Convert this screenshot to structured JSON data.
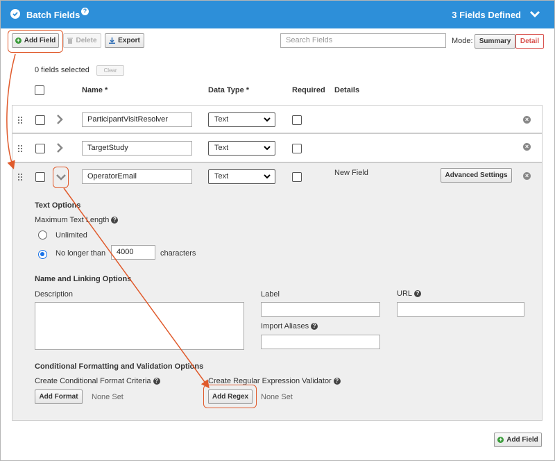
{
  "header": {
    "title": "Batch Fields",
    "help_icon": "?",
    "fields_count": "3 Fields Defined",
    "bg_color": "#2d8fd9"
  },
  "toolbar": {
    "add_field": "Add Field",
    "delete": "Delete",
    "export": "Export",
    "search_placeholder": "Search Fields",
    "mode_label": "Mode:",
    "mode_summary": "Summary",
    "mode_detail": "Detail"
  },
  "selection": {
    "selected_text": "0 fields selected",
    "clear": "Clear"
  },
  "columns": {
    "name": "Name *",
    "data_type": "Data Type *",
    "required": "Required",
    "details": "Details"
  },
  "fields": [
    {
      "name": "ParticipantVisitResolver",
      "type": "Text",
      "details": ""
    },
    {
      "name": "TargetStudy",
      "type": "Text",
      "details": ""
    },
    {
      "name": "OperatorEmail",
      "type": "Text",
      "details": "New Field",
      "advanced": "Advanced Settings"
    }
  ],
  "text_options": {
    "title": "Text Options",
    "max_length_label": "Maximum Text Length",
    "unlimited": "Unlimited",
    "no_longer_than": "No longer than",
    "max_value": "4000",
    "characters": "characters"
  },
  "naming": {
    "title": "Name and Linking Options",
    "description": "Description",
    "label": "Label",
    "url": "URL",
    "import_aliases": "Import Aliases"
  },
  "conditional": {
    "title": "Conditional Formatting and Validation Options",
    "format_label": "Create Conditional Format Criteria",
    "add_format": "Add Format",
    "format_none": "None Set",
    "regex_label": "Create Regular Expression Validator",
    "add_regex": "Add Regex",
    "regex_none": "None Set"
  },
  "footer": {
    "add_field": "Add Field"
  },
  "colors": {
    "accent": "#2d8fd9",
    "callout": "#e05a2b",
    "detail_mode": "#d9534f"
  }
}
